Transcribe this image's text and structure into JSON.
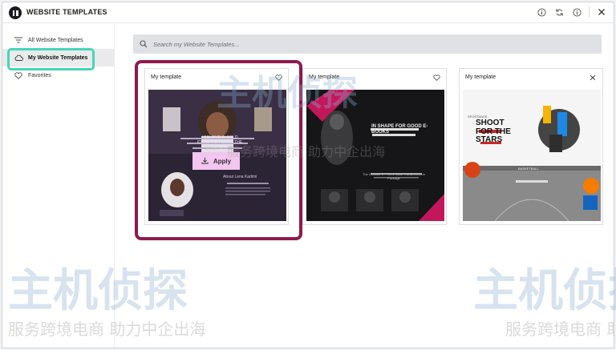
{
  "header": {
    "title": "WEBSITE TEMPLATES",
    "icons": [
      "info-icon",
      "sync-icon",
      "help-icon",
      "close-icon"
    ]
  },
  "sidebar": {
    "items": [
      {
        "label": "All Website Templates",
        "icon": "filter-icon",
        "active": false
      },
      {
        "label": "My Website Templates",
        "icon": "cloud-icon",
        "active": true
      },
      {
        "label": "Favorites",
        "icon": "heart-icon",
        "active": false
      }
    ]
  },
  "search": {
    "placeholder": "Search my Website Templates..."
  },
  "cards": [
    {
      "title": "My template",
      "action_icon": "heart-icon",
      "thumb": {
        "headline": "I BELIEVE IN BOLD IDEAS THAT BUILD THE FUTURE",
        "subheading": "About Lena Kadimi"
      },
      "apply_label": "Apply"
    },
    {
      "title": "My template",
      "action_icon": "heart-icon",
      "thumb": {
        "headline": "IN SHAPE FOR GOOD E-BOOKS",
        "subheading": "The Ultimate 3 - Three Book Transformation Package"
      }
    },
    {
      "title": "My template",
      "action_icon": "close-icon",
      "thumb": {
        "brand": "SPORTANCE",
        "headline": "SHOOT FOR THE STARS",
        "subheading": "BASKETBALL"
      }
    }
  ],
  "watermark": {
    "logo_text": "主机侦探",
    "tagline": "服务跨境电商 助力中企出海"
  },
  "colors": {
    "accent_select": "#8f1a4e",
    "highlight": "#47d6b6",
    "apply_bg": "#f2c6ee"
  }
}
